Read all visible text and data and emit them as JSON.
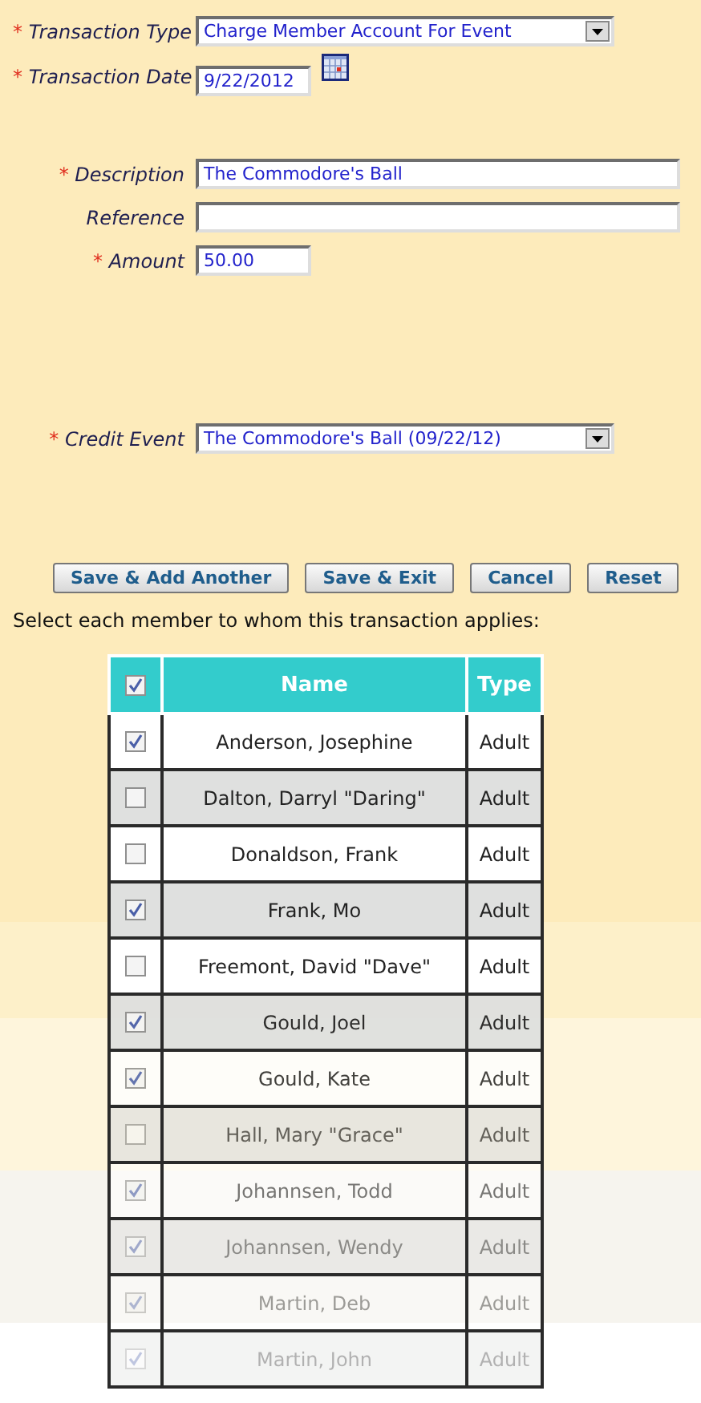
{
  "form": {
    "fields": [
      {
        "kind": "select",
        "label": "Transaction Type",
        "required_mark": "*",
        "value": "Charge Member Account For Event"
      },
      {
        "kind": "date",
        "label": "Transaction Date",
        "required_mark": "*",
        "value": "9/22/2012"
      },
      {
        "kind": "gap"
      },
      {
        "kind": "text",
        "label": "Description",
        "required_mark": "*",
        "value": "The Commodore's Ball"
      },
      {
        "kind": "text",
        "label": "Reference"
      },
      {
        "kind": "amount",
        "label": "Amount",
        "required_mark": "*",
        "value": "50.00"
      },
      {
        "kind": "gap"
      },
      {
        "kind": "select",
        "label": "Credit Event",
        "required_mark": "*",
        "value": "The Commodore's Ball (09/22/12)"
      }
    ]
  },
  "buttons": [
    "Save & Add Another",
    "Save & Exit",
    "Cancel",
    "Reset"
  ],
  "instruction": "Select each member to whom this transaction applies:",
  "members": {
    "select_all_checked": true,
    "columns": [
      "Name",
      "Type"
    ],
    "rows": [
      {
        "name": "Anderson, Josephine",
        "type": "Adult",
        "checked": true
      },
      {
        "name": "Dalton, Darryl \"Daring\"",
        "type": "Adult",
        "checked": false
      },
      {
        "name": "Donaldson, Frank",
        "type": "Adult",
        "checked": false
      },
      {
        "name": "Frank, Mo",
        "type": "Adult",
        "checked": true
      },
      {
        "name": "Freemont, David \"Dave\"",
        "type": "Adult",
        "checked": false
      },
      {
        "name": "Gould, Joel",
        "type": "Adult",
        "checked": true
      },
      {
        "name": "Gould, Kate",
        "type": "Adult",
        "checked": true
      },
      {
        "name": "Hall, Mary \"Grace\"",
        "type": "Adult",
        "checked": false
      },
      {
        "name": "Johannsen, Todd",
        "type": "Adult",
        "checked": true
      },
      {
        "name": "Johannsen, Wendy",
        "type": "Adult",
        "checked": true
      },
      {
        "name": "Martin, Deb",
        "type": "Adult",
        "checked": true
      },
      {
        "name": "Martin, John",
        "type": "Adult",
        "checked": true
      }
    ]
  }
}
